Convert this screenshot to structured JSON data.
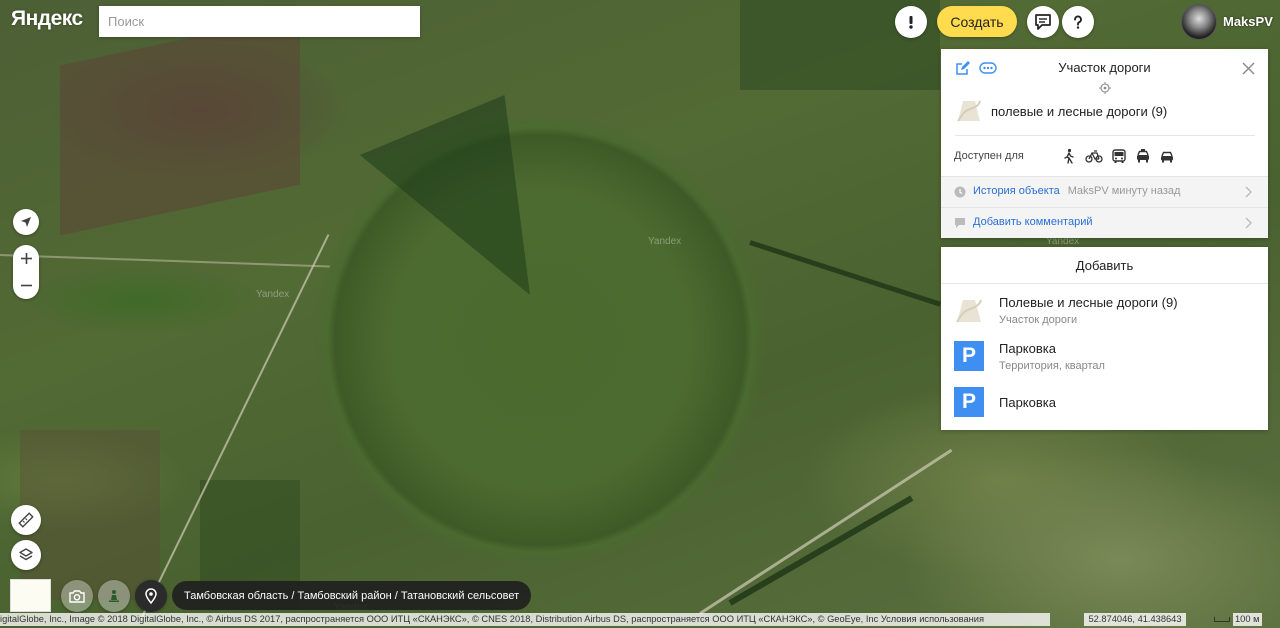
{
  "header": {
    "logo": "Яндекс",
    "search_placeholder": "Поиск",
    "create_label": "Создать",
    "username": "MaksPV"
  },
  "map": {
    "watermark": "Yandex",
    "breadcrumbs": "Тамбовская область / Тамбовский район / Татановский сельсовет",
    "attribution": "igitalGlobe, Inc., Image © 2018 DigitalGlobe, Inc., © Airbus DS 2017, распространяется ООО ИТЦ «СКАНЭКС», © CNES 2018, Distribution Airbus DS, распространяется ООО ИТЦ «СКАНЭКС», © GeoEye, Inc",
    "terms_link": "Условия использования",
    "coordinates": "52.874046, 41.438643",
    "scale_label": "100 м"
  },
  "object_panel": {
    "title": "Участок дороги",
    "category": "полевые и лесные дороги (9)",
    "access_label": "Доступен для",
    "access_icons": [
      "pedestrian-icon",
      "bicycle-icon",
      "bus-icon",
      "taxi-icon",
      "car-icon"
    ],
    "history_label": "История объекта",
    "history_meta": "MaksPV минуту назад",
    "comment_label": "Добавить комментарий"
  },
  "add_panel": {
    "title": "Добавить",
    "items": [
      {
        "name": "Полевые и лесные дороги (9)",
        "subtitle": "Участок дороги",
        "icon": "road-section-icon"
      },
      {
        "name": "Парковка",
        "subtitle": "Территория, квартал",
        "icon": "parking-icon"
      },
      {
        "name": "Парковка",
        "subtitle": "",
        "icon": "parking-icon"
      }
    ],
    "parking_letter": "P"
  },
  "colors": {
    "accent_yellow": "#ffdb4d",
    "link_blue": "#2a6fd4",
    "parking_blue": "#3f8ef2"
  }
}
